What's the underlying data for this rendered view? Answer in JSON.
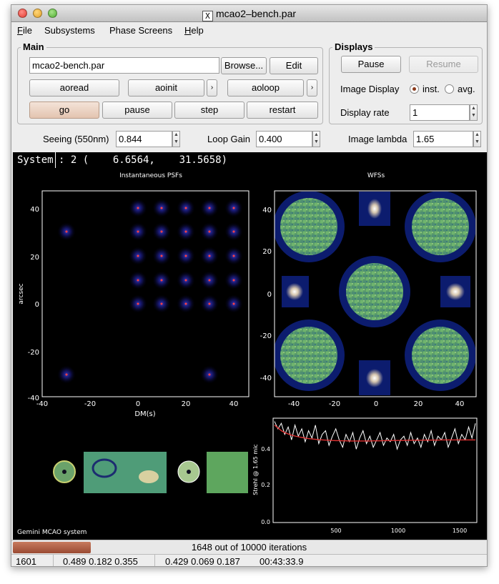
{
  "window": {
    "title": "mcao2–bench.par",
    "x_logo": "X"
  },
  "menu": {
    "file": {
      "first": "F",
      "rest": "ile"
    },
    "subsystems": "Subsystems",
    "phase_screens": "Phase Screens",
    "help": {
      "first": "H",
      "rest": "elp"
    }
  },
  "main": {
    "title": "Main",
    "parfile": "mcao2-bench.par",
    "browse_label": "Browse...",
    "edit_label": "Edit",
    "aoread_label": "aoread",
    "aoinit_label": "aoinit",
    "aoloop_label": "aoloop",
    "arrow_glyph": "›",
    "go_label": "go",
    "pause_label": "pause",
    "step_label": "step",
    "restart_label": "restart"
  },
  "displays": {
    "title": "Displays",
    "pause_label": "Pause",
    "resume_label": "Resume",
    "image_display_label": "Image Display",
    "option_inst": "inst.",
    "option_avg": "avg.",
    "selected": "inst.",
    "display_rate_label": "Display rate",
    "display_rate_value": "1"
  },
  "params": {
    "seeing_label": "Seeing (550nm)",
    "seeing_value": "0.844",
    "loop_gain_label": "Loop Gain",
    "loop_gain_value": "0.400",
    "image_lambda_label": "Image lambda",
    "image_lambda_value": "1.65"
  },
  "system_bar": {
    "label": "System",
    "value": ": 2 (    6.6564,    31.5658)"
  },
  "plots": {
    "psf_title": "Instantaneous PSFs",
    "psf_xlabel": "DM(s)",
    "psf_ylabel": "arcsec",
    "psf_xticks": [
      "-40",
      "-20",
      "0",
      "20",
      "40"
    ],
    "psf_yticks": [
      "40",
      "20",
      "0",
      "-20",
      "-40"
    ],
    "wfs_title": "WFSs",
    "wfs_xticks": [
      "-40",
      "-20",
      "0",
      "20",
      "40"
    ],
    "wfs_yticks": [
      "40",
      "20",
      "0",
      "-20",
      "-40"
    ],
    "strehl_ylabel": "Strehl @ 1.65 mic",
    "strehl_xticks": [
      "500",
      "1000",
      "1500"
    ],
    "strehl_yticks": [
      "0.0",
      "0.2",
      "0.4"
    ],
    "footer": "Gemini MCAO system"
  },
  "chart_data": {
    "type": "line",
    "x_range": [
      1,
      1648
    ],
    "ylim": [
      0,
      0.55
    ],
    "ylabel": "Strehl @ 1.65 mic",
    "series": [
      {
        "values": [
          0.54,
          0.5,
          0.53,
          0.47,
          0.51,
          0.44,
          0.52,
          0.46,
          0.5,
          0.43,
          0.49,
          0.45,
          0.52,
          0.42,
          0.47,
          0.49,
          0.41,
          0.46,
          0.5,
          0.44,
          0.4,
          0.47,
          0.43,
          0.48,
          0.39,
          0.45,
          0.49,
          0.42,
          0.46,
          0.4,
          0.44,
          0.48,
          0.41,
          0.45,
          0.43,
          0.47,
          0.39,
          0.44,
          0.46,
          0.41,
          0.48,
          0.42,
          0.45,
          0.4,
          0.47,
          0.43,
          0.49,
          0.41,
          0.46,
          0.44,
          0.48,
          0.4,
          0.45,
          0.5,
          0.42,
          0.47,
          0.44,
          0.51,
          0.45,
          0.53
        ],
        "color": "#ffffff"
      },
      {
        "values": [
          0.52,
          0.505,
          0.49,
          0.48,
          0.472,
          0.466,
          0.461,
          0.457,
          0.453,
          0.45,
          0.447,
          0.445,
          0.443,
          0.441,
          0.44,
          0.439,
          0.438,
          0.437,
          0.436,
          0.436,
          0.435,
          0.435,
          0.434,
          0.434,
          0.434,
          0.434,
          0.434,
          0.434,
          0.434,
          0.435,
          0.435,
          0.435,
          0.436,
          0.436,
          0.436,
          0.437,
          0.437,
          0.437,
          0.437,
          0.438,
          0.438,
          0.438,
          0.438,
          0.438,
          0.439,
          0.439,
          0.439,
          0.439,
          0.439,
          0.44,
          0.44,
          0.44,
          0.44,
          0.44,
          0.44,
          0.44,
          0.44,
          0.44,
          0.44,
          0.44
        ],
        "color": "#e03030"
      }
    ]
  },
  "progress": {
    "text": "1648 out of 10000 iterations",
    "fraction": 0.1648
  },
  "status": {
    "iteration": "1601",
    "values_a": "0.489 0.182 0.355",
    "values_b": "0.429 0.069 0.187",
    "elapsed": "00:43:33.9"
  },
  "colors": {
    "psf_star": "#ff4040",
    "wfs_green": "#5fae6a",
    "wfs_navy": "#0c1c6e",
    "strehl_avg": "#e03030"
  }
}
